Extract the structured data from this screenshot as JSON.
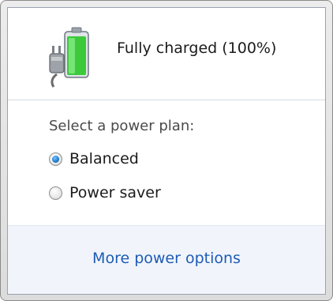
{
  "status": {
    "text": "Fully charged (100%)",
    "icon": "battery-plug-icon",
    "charge_fraction": 1.0
  },
  "power_plan": {
    "heading": "Select a power plan:",
    "options": [
      {
        "label": "Balanced",
        "selected": true
      },
      {
        "label": "Power saver",
        "selected": false
      }
    ]
  },
  "footer": {
    "link_label": "More power options"
  },
  "colors": {
    "link": "#1e5bb5",
    "battery_fill": "#3cc93c",
    "footer_bg": "#f1f5fb"
  }
}
